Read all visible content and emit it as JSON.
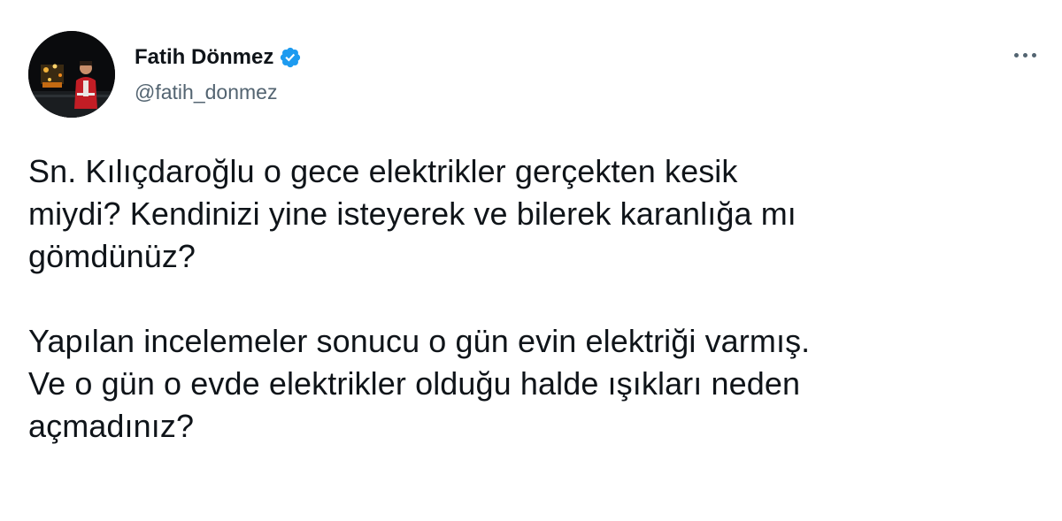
{
  "author": {
    "display_name": "Fatih Dönmez",
    "handle": "@fatih_donmez",
    "verified_icon": "verified-badge-icon",
    "avatar_icon": "profile-photo"
  },
  "menu": {
    "icon": "more-options-icon"
  },
  "tweet": {
    "paragraphs": [
      "Sn. Kılıçdaroğlu o gece elektrikler gerçekten kesik\nmiydi? Kendinizi yine isteyerek ve bilerek karanlığa mı\ngömdünüz?",
      "Yapılan incelemeler sonucu o gün evin elektriği varmış.\nVe o gün o evde elektrikler olduğu halde ışıkları neden\naçmadınız?"
    ]
  },
  "colors": {
    "text": "#0f1419",
    "secondary": "#536471",
    "verified": "#1d9bf0"
  }
}
